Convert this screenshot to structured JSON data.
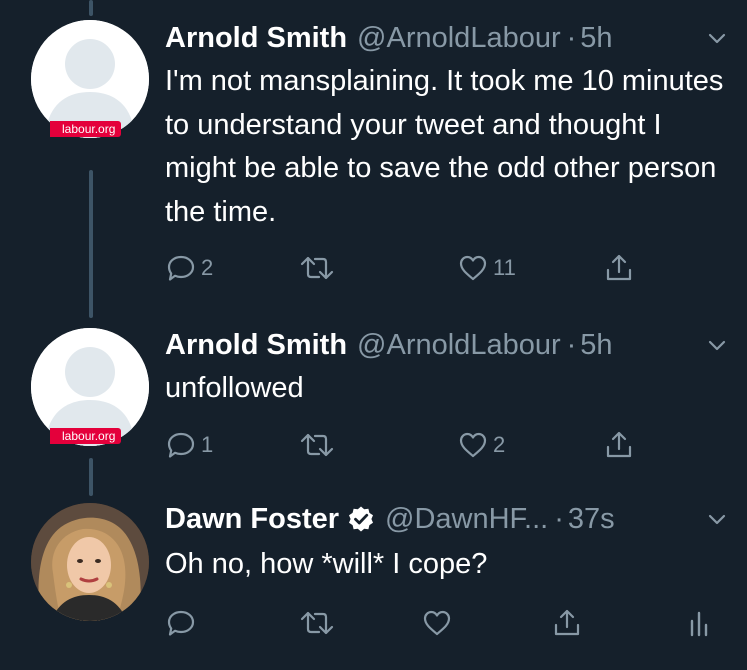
{
  "tweets": [
    {
      "name": "Arnold Smith",
      "handle": "@ArnoldLabour",
      "time": "5h",
      "badge": "labour.org",
      "body": "I'm not mansplaining.  It took me 10 minutes to understand your tweet and thought I might be able to save the odd other person the time.",
      "replies": "2",
      "retweets": "",
      "likes": "11"
    },
    {
      "name": "Arnold Smith",
      "handle": "@ArnoldLabour",
      "time": "5h",
      "badge": "labour.org",
      "body": "unfollowed",
      "replies": "1",
      "retweets": "",
      "likes": "2"
    },
    {
      "name": "Dawn Foster",
      "handle": "@DawnHF...",
      "time": "37s",
      "body": "Oh no, how *will* I cope?",
      "replies": "",
      "retweets": "",
      "likes": ""
    }
  ],
  "colors": {
    "background": "#15202b",
    "muted": "#8899a6",
    "thread_line": "#3d5466",
    "badge": "#e4003b",
    "verified": "#ffffff"
  },
  "icons": {
    "reply": "reply-icon",
    "retweet": "retweet-icon",
    "like": "heart-icon",
    "share": "share-icon",
    "analytics": "analytics-icon",
    "caret": "chevron-down-icon",
    "verified": "verified-badge-icon"
  }
}
